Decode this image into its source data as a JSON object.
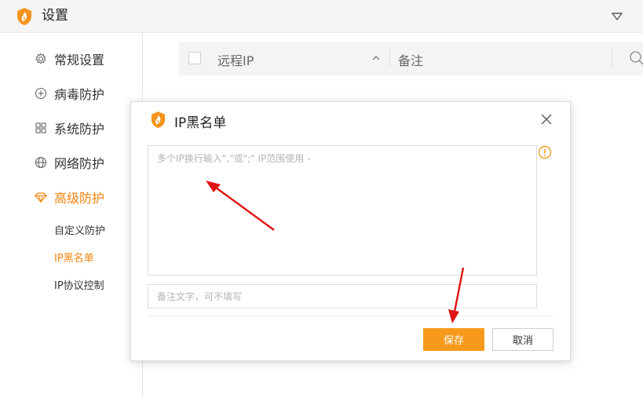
{
  "app": {
    "title": "设置",
    "accent": "#f5820a",
    "logo_icon": "flame-shield-icon",
    "menu_icon": "dropdown-triangle-icon"
  },
  "sidebar": {
    "items": [
      {
        "label": "常规设置",
        "icon": "gear-icon"
      },
      {
        "label": "病毒防护",
        "icon": "plus-circle-icon"
      },
      {
        "label": "系统防护",
        "icon": "grid-icon"
      },
      {
        "label": "网络防护",
        "icon": "globe-icon"
      },
      {
        "label": "高级防护",
        "icon": "diamond-icon",
        "active": true
      }
    ],
    "sub_items": [
      {
        "label": "自定义防护"
      },
      {
        "label": "IP黑名单",
        "active": true
      },
      {
        "label": "IP协议控制"
      }
    ]
  },
  "table": {
    "col_remote_ip": "远程IP",
    "col_note": "备注",
    "sort_icon": "sort-up-icon",
    "search_icon": "search-icon"
  },
  "dialog": {
    "title": "IP黑名单",
    "ip_placeholder": "多个IP换行输入\",\"或\";\" IP范围使用 -",
    "note_placeholder": "备注文字，可不填写",
    "save_label": "保存",
    "cancel_label": "取消",
    "save_color": "#f79a1c",
    "warn_color": "#f0a020"
  },
  "annotations": {
    "arrow_color": "#e01414"
  }
}
